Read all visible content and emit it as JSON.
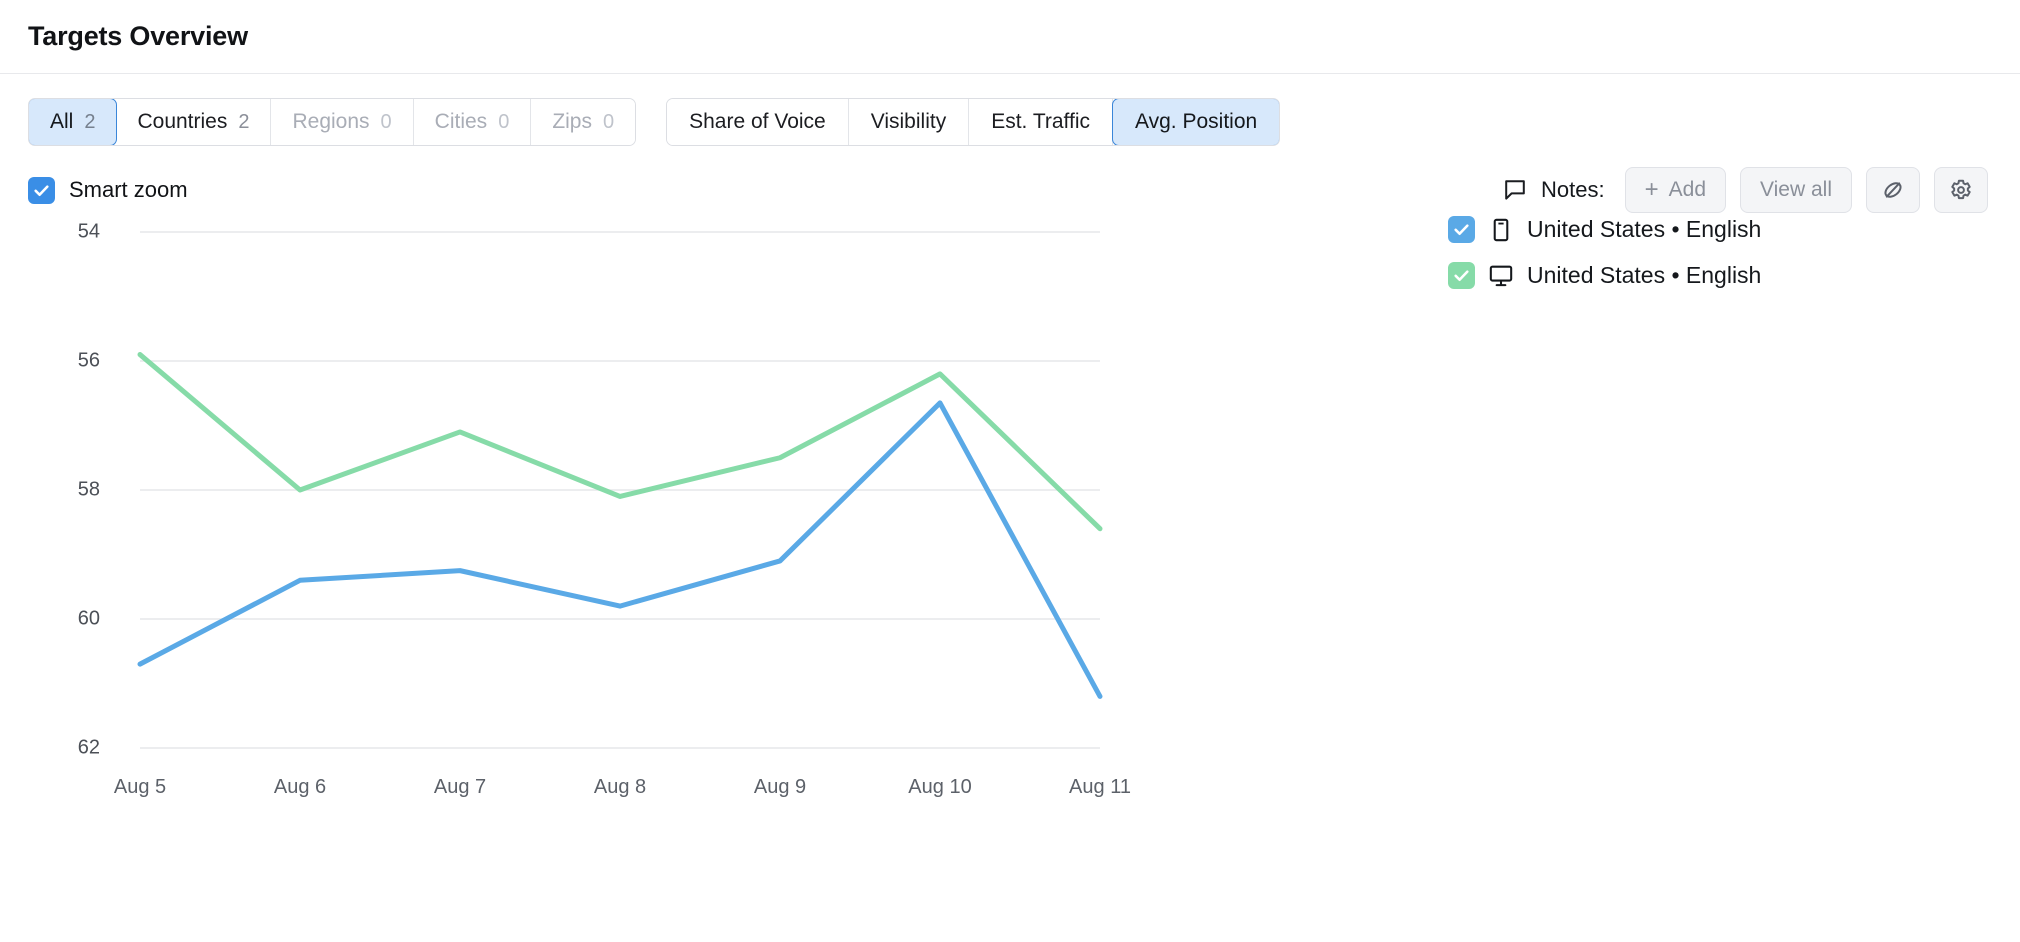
{
  "header": {
    "title": "Targets Overview"
  },
  "scope_tabs": [
    {
      "label": "All",
      "count": "2",
      "active": true,
      "muted": false
    },
    {
      "label": "Countries",
      "count": "2",
      "active": false,
      "muted": false
    },
    {
      "label": "Regions",
      "count": "0",
      "active": false,
      "muted": true
    },
    {
      "label": "Cities",
      "count": "0",
      "active": false,
      "muted": true
    },
    {
      "label": "Zips",
      "count": "0",
      "active": false,
      "muted": true
    }
  ],
  "metric_tabs": [
    {
      "label": "Share of Voice",
      "active": false
    },
    {
      "label": "Visibility",
      "active": false
    },
    {
      "label": "Est. Traffic",
      "active": false
    },
    {
      "label": "Avg. Position",
      "active": true
    }
  ],
  "smart_zoom": {
    "label": "Smart zoom",
    "checked": true
  },
  "notes": {
    "label": "Notes:",
    "add_label": "Add",
    "add_plus": "+",
    "view_all_label": "View all"
  },
  "legend": [
    {
      "label": "United States • English",
      "device": "mobile",
      "color": "#5aa9e6",
      "checked": true
    },
    {
      "label": "United States • English",
      "device": "desktop",
      "color": "#86dba8",
      "checked": true
    }
  ],
  "colors": {
    "accent_blue": "#3a8ee6",
    "series_blue": "#5aa9e6",
    "series_green": "#86dba8",
    "active_tab_bg": "#d7e8fb",
    "active_tab_border": "#3a86d9",
    "gridline": "#e6e7ea"
  },
  "chart_data": {
    "type": "line",
    "title": "Avg. Position",
    "xlabel": "",
    "ylabel": "",
    "grid": true,
    "legend_position": "right",
    "y_inverted": true,
    "ylim": [
      54,
      62
    ],
    "yticks": [
      54,
      56,
      58,
      60,
      62
    ],
    "categories": [
      "Aug 5",
      "Aug 6",
      "Aug 7",
      "Aug 8",
      "Aug 9",
      "Aug 10",
      "Aug 11"
    ],
    "series": [
      {
        "name": "United States • English (Desktop)",
        "color": "#86dba8",
        "values": [
          55.9,
          58.0,
          57.1,
          58.1,
          57.5,
          56.2,
          58.6
        ]
      },
      {
        "name": "United States • English (Mobile)",
        "color": "#5aa9e6",
        "values": [
          60.7,
          59.4,
          59.25,
          59.8,
          59.1,
          56.65,
          61.2
        ]
      }
    ]
  }
}
